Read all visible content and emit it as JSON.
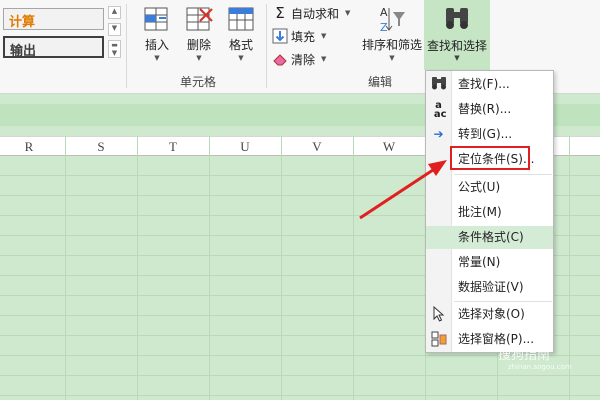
{
  "styles": {
    "calc": "计算",
    "output": "输出"
  },
  "cells_group": {
    "label": "单元格",
    "buttons": [
      {
        "label": "插入"
      },
      {
        "label": "删除"
      },
      {
        "label": "格式"
      }
    ]
  },
  "edit_group": {
    "label": "编辑",
    "autosum": "自动求和",
    "fill": "填充",
    "clear": "清除",
    "sort_filter": "排序和筛选",
    "find_select": "查找和选择"
  },
  "columns": [
    "R",
    "S",
    "T",
    "U",
    "V",
    "W"
  ],
  "menu": {
    "items": [
      {
        "label": "查找(F)...",
        "icon": "binoculars-icon"
      },
      {
        "label": "替换(R)...",
        "icon": "replace-icon"
      },
      {
        "label": "转到(G)...",
        "icon": "arrow-right-icon"
      },
      {
        "label": "定位条件(S)...",
        "icon": ""
      },
      {
        "label": "公式(U)",
        "icon": ""
      },
      {
        "label": "批注(M)",
        "icon": ""
      },
      {
        "label": "条件格式(C)",
        "icon": "",
        "highlighted": true
      },
      {
        "label": "常量(N)",
        "icon": ""
      },
      {
        "label": "数据验证(V)",
        "icon": ""
      },
      {
        "label": "选择对象(O)",
        "icon": "cursor-icon"
      },
      {
        "label": "选择窗格(P)...",
        "icon": "selection-pane-icon"
      }
    ]
  },
  "watermark": {
    "main": "搜狗指南",
    "sub": "zhinan.sogou.com"
  },
  "colors": {
    "accent_green": "#c5e5c5",
    "sheet_bg": "#cfe9cf",
    "annotation_red": "#e02020",
    "calc_text": "#e07a00"
  }
}
